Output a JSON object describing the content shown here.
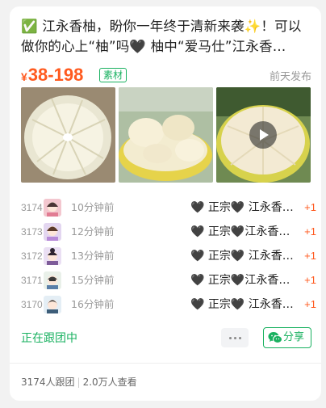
{
  "post": {
    "title": "✅ 江永香柚，盼你一年终于清新来袭✨！可以做你的心上“柚”吗🖤 柚中“爱马仕”江永香柚，…",
    "price_symbol": "¥",
    "price_range": "38-198",
    "badge": "素材",
    "posted_time": "前天发布"
  },
  "orders": [
    {
      "no": "3174",
      "time": "10分钟前",
      "item": "🖤 正宗🖤 江永香柚…",
      "qty": "+1"
    },
    {
      "no": "3173",
      "time": "12分钟前",
      "item": "🖤 正宗🖤江永香柚…",
      "qty": "+1"
    },
    {
      "no": "3172",
      "time": "13分钟前",
      "item": "🖤 正宗🖤 江永香…",
      "qty": "+1"
    },
    {
      "no": "3171",
      "time": "15分钟前",
      "item": "🖤 正宗🖤江永香柚…",
      "qty": "+1"
    },
    {
      "no": "3170",
      "time": "16分钟前",
      "item": "🖤 正宗🖤 江永香…",
      "qty": "+1"
    }
  ],
  "actions": {
    "following_label": "正在跟团中",
    "share_label": "分享"
  },
  "stats": {
    "joined": "3174人跟团",
    "views": "2.0万人查看"
  },
  "colors": {
    "accent_green": "#19b160",
    "price_orange": "#ff5a1f"
  }
}
